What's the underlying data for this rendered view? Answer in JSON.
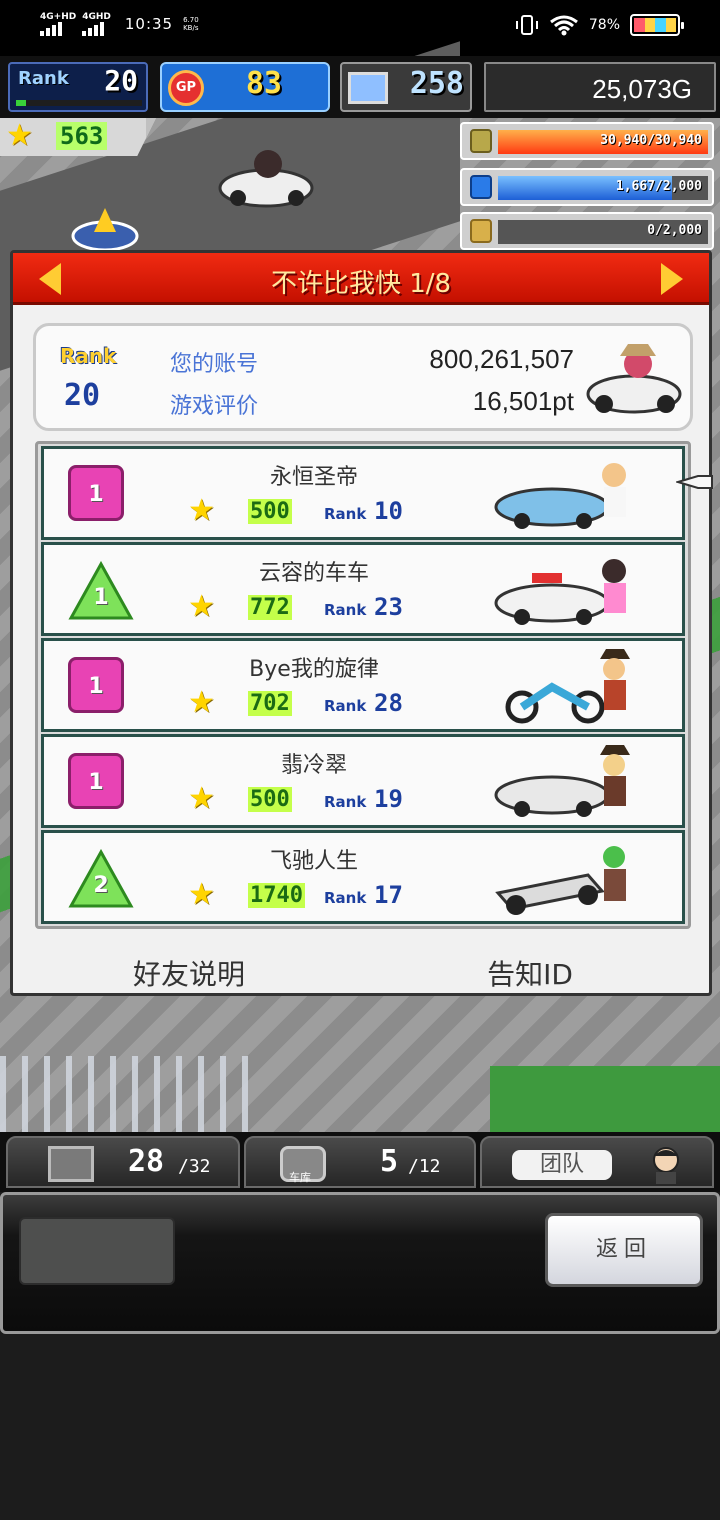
{
  "status_bar": {
    "net1": "4G+HD",
    "net2": "4GHD",
    "time": "10:35",
    "speed_value": "6.70",
    "speed_unit": "KB/s",
    "battery": "78%"
  },
  "hud": {
    "rank_label": "Rank",
    "rank_value": "20",
    "gp_icon": "GP",
    "gp_value": "83",
    "pc_value": "258",
    "money": "25,073G",
    "fans": "563",
    "resources": [
      {
        "icon": "coin-stack-icon",
        "text": "30,940/30,940",
        "fill": 1.0,
        "color": "#ff7a12"
      },
      {
        "icon": "fuel-can-icon",
        "text": "1,667/2,000",
        "fill": 0.83,
        "color": "#1d77e6"
      },
      {
        "icon": "wheat-icon",
        "text": "0/2,000",
        "fill": 0.0,
        "color": "#7a7a7a"
      }
    ]
  },
  "dialog": {
    "title": "不许比我快 1/8",
    "account": {
      "rank_label": "Rank",
      "rank_value": "20",
      "account_label": "您的账号",
      "account_value": "800,261,507",
      "rating_label": "游戏评价",
      "rating_value": "16,501pt"
    },
    "rows": [
      {
        "badge": "1",
        "shape": "square",
        "name": "永恒圣帝",
        "fans": "500",
        "rank_label": "Rank",
        "rank": "10",
        "car": "#7fc0e8"
      },
      {
        "badge": "1",
        "shape": "triangle",
        "name": "云容的车车",
        "fans": "772",
        "rank_label": "Rank",
        "rank": "23",
        "car": "#f2f2f2"
      },
      {
        "badge": "1",
        "shape": "square",
        "name": "Bye我的旋律",
        "fans": "702",
        "rank_label": "Rank",
        "rank": "28",
        "car": "#3aa8d8"
      },
      {
        "badge": "1",
        "shape": "square",
        "name": "翡冷翠",
        "fans": "500",
        "rank_label": "Rank",
        "rank": "19",
        "car": "#e8e8e8"
      },
      {
        "badge": "2",
        "shape": "triangle",
        "name": "飞驰人生",
        "fans": "1740",
        "rank_label": "Rank",
        "rank": "17",
        "car": "#dcdcdc"
      }
    ],
    "footer_left": "好友说明",
    "footer_right": "告知ID"
  },
  "bottom_tabs": {
    "crates_count": "28",
    "crates_max": "/32",
    "garage_label": "车库",
    "garage_count": "5",
    "garage_max": "/12",
    "team_label": "团队"
  },
  "bottom_panel": {
    "back_label": "返回"
  }
}
